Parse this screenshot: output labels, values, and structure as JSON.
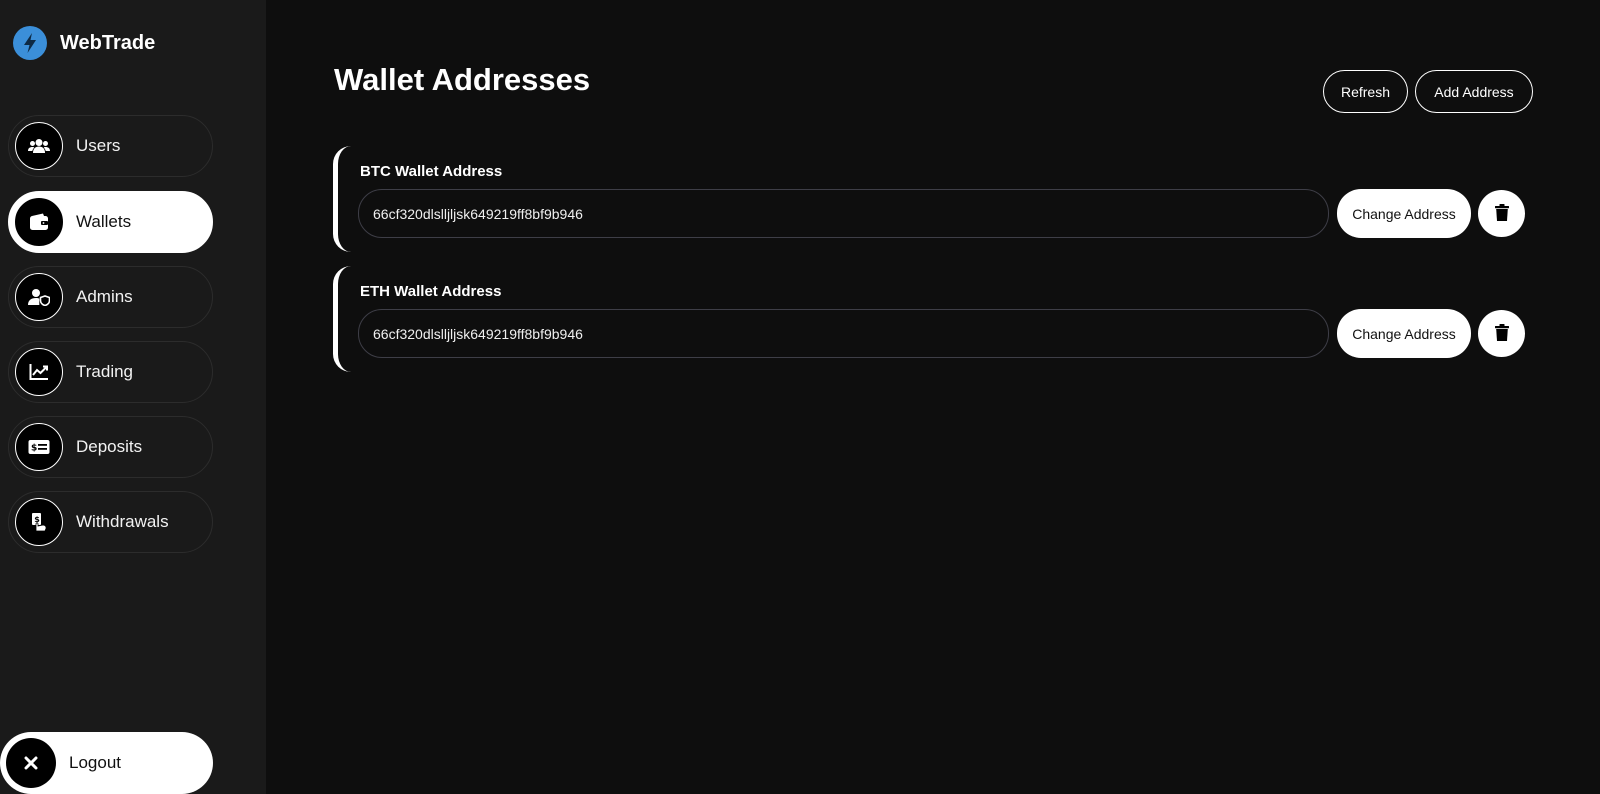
{
  "brand": {
    "name": "WebTrade",
    "logo_icon": "lightning-bolt-icon",
    "logo_color": "#3b8fd9"
  },
  "sidebar": {
    "items": [
      {
        "label": "Users",
        "icon": "users-icon",
        "active": false
      },
      {
        "label": "Wallets",
        "icon": "wallet-icon",
        "active": true
      },
      {
        "label": "Admins",
        "icon": "admin-shield-icon",
        "active": false
      },
      {
        "label": "Trading",
        "icon": "chart-icon",
        "active": false
      },
      {
        "label": "Deposits",
        "icon": "money-check-icon",
        "active": false
      },
      {
        "label": "Withdrawals",
        "icon": "hand-money-icon",
        "active": false
      }
    ],
    "logout": {
      "label": "Logout",
      "icon": "close-icon"
    }
  },
  "main": {
    "title": "Wallet Addresses",
    "refresh_label": "Refresh",
    "add_label": "Add Address",
    "wallets": [
      {
        "label": "BTC Wallet Address",
        "value": "66cf320dlslljljsk649219ff8bf9b946",
        "change_label": "Change Address",
        "delete_icon": "trash-icon"
      },
      {
        "label": "ETH Wallet Address",
        "value": "66cf320dlslljljsk649219ff8bf9b946",
        "change_label": "Change Address",
        "delete_icon": "trash-icon"
      }
    ]
  },
  "colors": {
    "background": "#0e0e0e",
    "sidebar": "#1a1a1a",
    "accent": "#ffffff",
    "input_border": "#3e3e47"
  }
}
